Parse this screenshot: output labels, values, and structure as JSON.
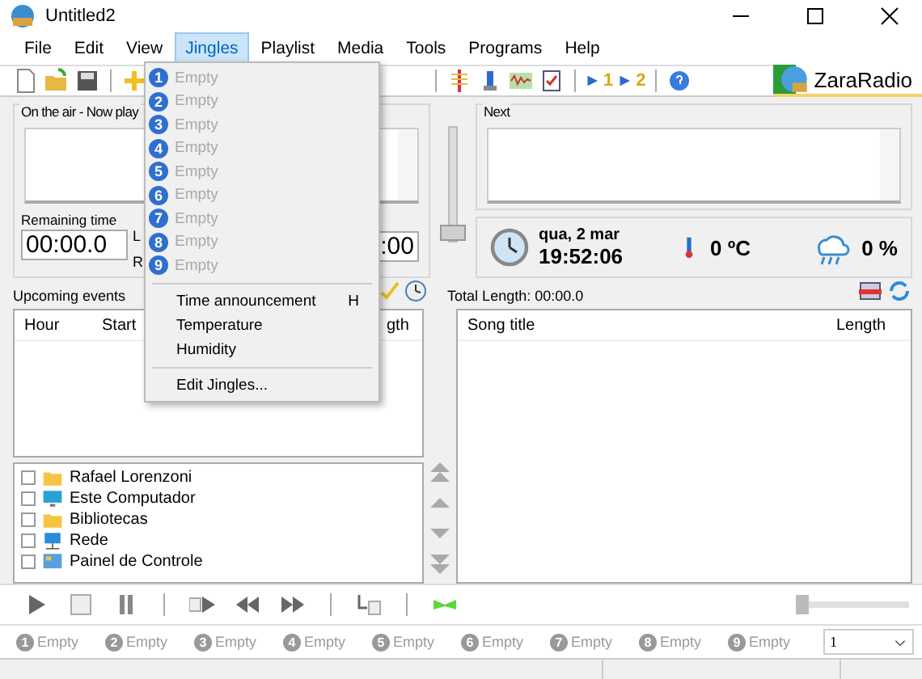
{
  "window": {
    "title": "Untitled2"
  },
  "menu_bar": [
    {
      "label": "File",
      "selected": false
    },
    {
      "label": "Edit",
      "selected": false
    },
    {
      "label": "View",
      "selected": false
    },
    {
      "label": "Jingles",
      "selected": true
    },
    {
      "label": "Playlist",
      "selected": false
    },
    {
      "label": "Media",
      "selected": false
    },
    {
      "label": "Tools",
      "selected": false
    },
    {
      "label": "Programs",
      "selected": false
    },
    {
      "label": "Help",
      "selected": false
    }
  ],
  "toolbar": {
    "logo": "ZaraRadio",
    "play_buttons": [
      "1",
      "2"
    ]
  },
  "jingles_menu": {
    "jingles": [
      {
        "number": "1",
        "label": "Empty",
        "disabled": true
      },
      {
        "number": "2",
        "label": "Empty",
        "disabled": true
      },
      {
        "number": "3",
        "label": "Empty",
        "disabled": true
      },
      {
        "number": "4",
        "label": "Empty",
        "disabled": true
      },
      {
        "number": "5",
        "label": "Empty",
        "disabled": true
      },
      {
        "number": "6",
        "label": "Empty",
        "disabled": true
      },
      {
        "number": "7",
        "label": "Empty",
        "disabled": true
      },
      {
        "number": "8",
        "label": "Empty",
        "disabled": true
      },
      {
        "number": "9",
        "label": "Empty",
        "disabled": true
      }
    ],
    "items": [
      {
        "label": "Time announcement",
        "shortcut": "H",
        "disabled": false
      },
      {
        "label": "Temperature",
        "disabled": false
      },
      {
        "label": "Humidity",
        "disabled": false
      },
      {
        "label": "Edit Jingles...",
        "disabled": false
      }
    ]
  },
  "on_air": {
    "title": "On the air - Now play",
    "remaining_label": "Remaining time",
    "remaining_time": "00:00.0",
    "label_l": "L",
    "label_r": "R",
    "time_fragment": ":00",
    "fader": {
      "level": 0
    }
  },
  "next": {
    "title": "Next"
  },
  "info": {
    "date": "qua, 2 mar",
    "time": "19:52:06",
    "temperature": "0 ºC",
    "humidity": "0 %"
  },
  "upcoming": {
    "title": "Upcoming events",
    "columns": [
      "Hour",
      "Start",
      "gth"
    ]
  },
  "file_tree": [
    {
      "label": "Rafael Lorenzoni",
      "kind": "folder"
    },
    {
      "label": "Este Computador",
      "kind": "computer"
    },
    {
      "label": "Bibliotecas",
      "kind": "folder"
    },
    {
      "label": "Rede",
      "kind": "network"
    },
    {
      "label": "Painel de Controle",
      "kind": "panel"
    }
  ],
  "playlist": {
    "total": "Total Length: 00:00.0",
    "columns": [
      "Song title",
      "Length"
    ]
  },
  "volume": {
    "level": 0
  },
  "jingle_bar": [
    {
      "number": "1",
      "label": "Empty"
    },
    {
      "number": "2",
      "label": "Empty"
    },
    {
      "number": "3",
      "label": "Empty"
    },
    {
      "number": "4",
      "label": "Empty"
    },
    {
      "number": "5",
      "label": "Empty"
    },
    {
      "number": "6",
      "label": "Empty"
    },
    {
      "number": "7",
      "label": "Empty"
    },
    {
      "number": "8",
      "label": "Empty"
    },
    {
      "number": "9",
      "label": "Empty"
    }
  ],
  "page_selector": {
    "value": "1"
  }
}
